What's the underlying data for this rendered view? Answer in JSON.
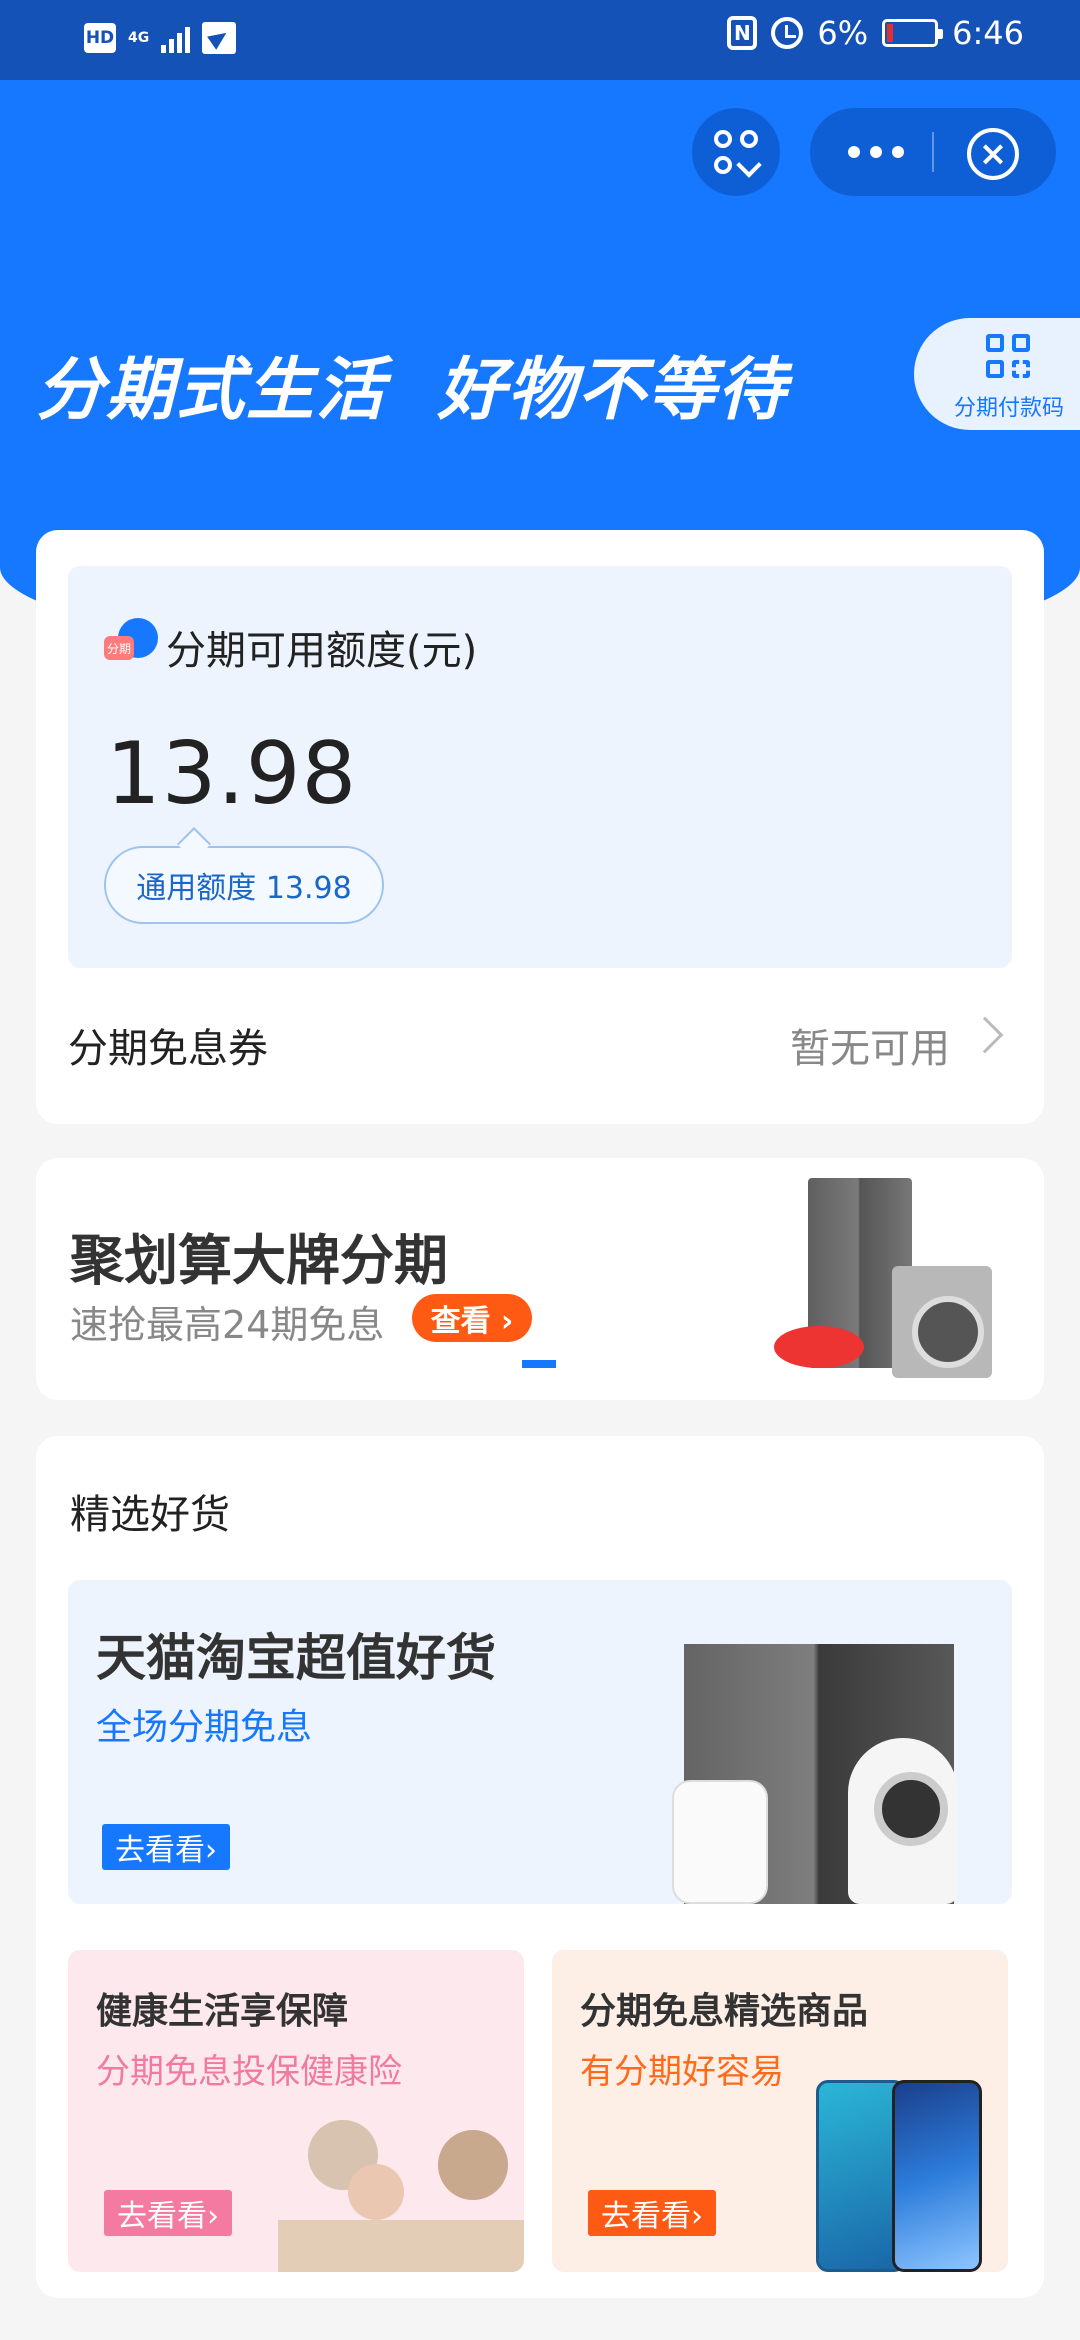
{
  "status_bar": {
    "hd": "HD",
    "network": "4G",
    "battery_percent": "6%",
    "time": "6:46",
    "nfc": "N"
  },
  "header": {
    "slogan": "分期式生活  好物不等待",
    "pay_code_label": "分期付款码",
    "close_glyph": "×"
  },
  "credit": {
    "title": "分期可用额度(元)",
    "amount": "13.98",
    "general_quota": "通用额度 13.98",
    "logo_text": "分期",
    "coupon_label": "分期免息券",
    "coupon_value": "暂无可用"
  },
  "promo_banner": {
    "title": "聚划算大牌分期",
    "subtitle": "速抢最高24期免息",
    "button": "查看 ›"
  },
  "goods": {
    "section_title": "精选好货",
    "main": {
      "title": "天猫淘宝超值好货",
      "subtitle": "全场分期免息",
      "button": "去看看›"
    },
    "cards": [
      {
        "title": "健康生活享保障",
        "subtitle": "分期免息投保健康险",
        "button": "去看看›"
      },
      {
        "title": "分期免息精选商品",
        "subtitle": "有分期好容易",
        "button": "去看看›"
      }
    ]
  },
  "colors": {
    "brand_blue": "#1677ff",
    "status_bar": "#1552b8",
    "accent_orange": "#ff5a14",
    "accent_pink": "#f47aa2"
  }
}
